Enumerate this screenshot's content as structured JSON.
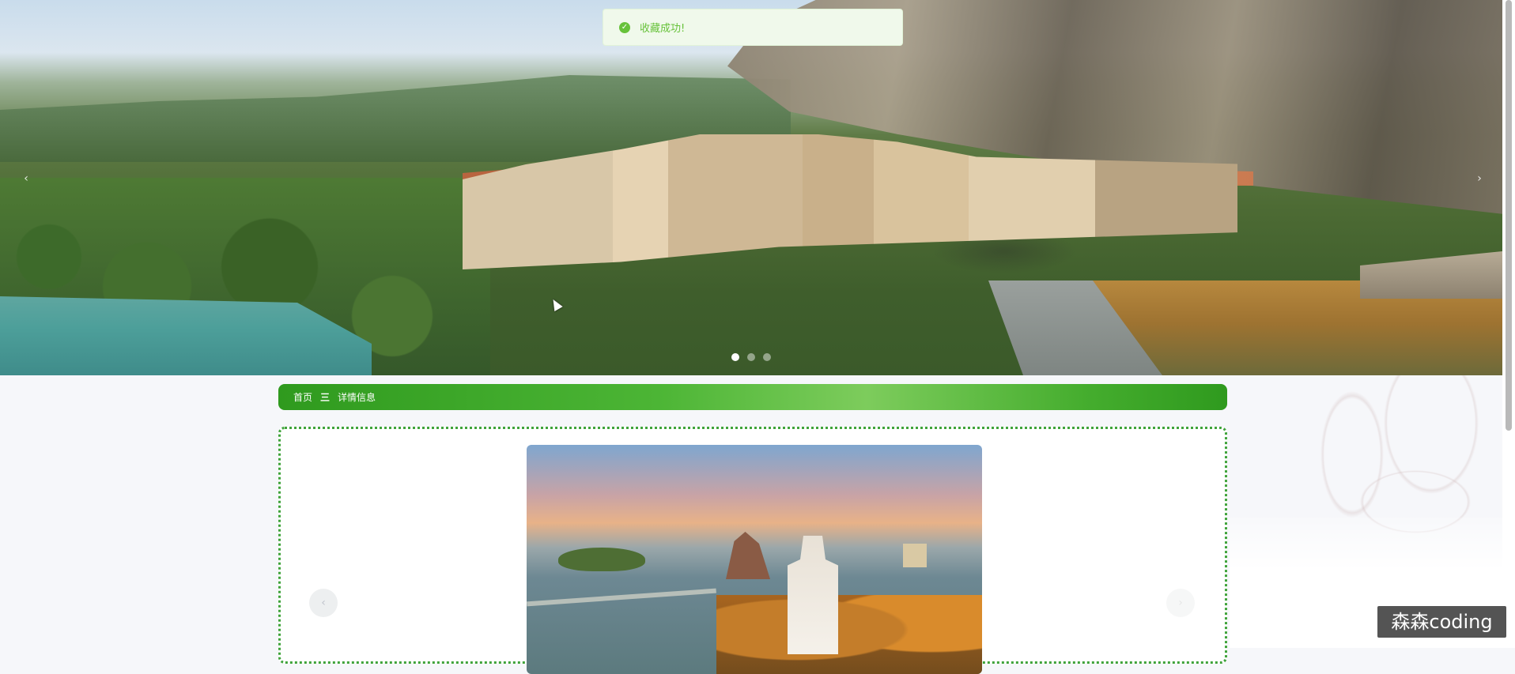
{
  "toast": {
    "message": "收藏成功!",
    "icon": "check-circle-icon",
    "color": "#67c23a"
  },
  "hero": {
    "prev_icon": "‹",
    "next_icon": "›",
    "dots": [
      true,
      false,
      false
    ]
  },
  "breadcrumb": {
    "home": "首页",
    "separator": "三",
    "current": "详情信息",
    "accent": "#3fa33a"
  },
  "detail": {
    "prev_icon": "‹",
    "next_icon": "›"
  },
  "watermark": "森森coding"
}
